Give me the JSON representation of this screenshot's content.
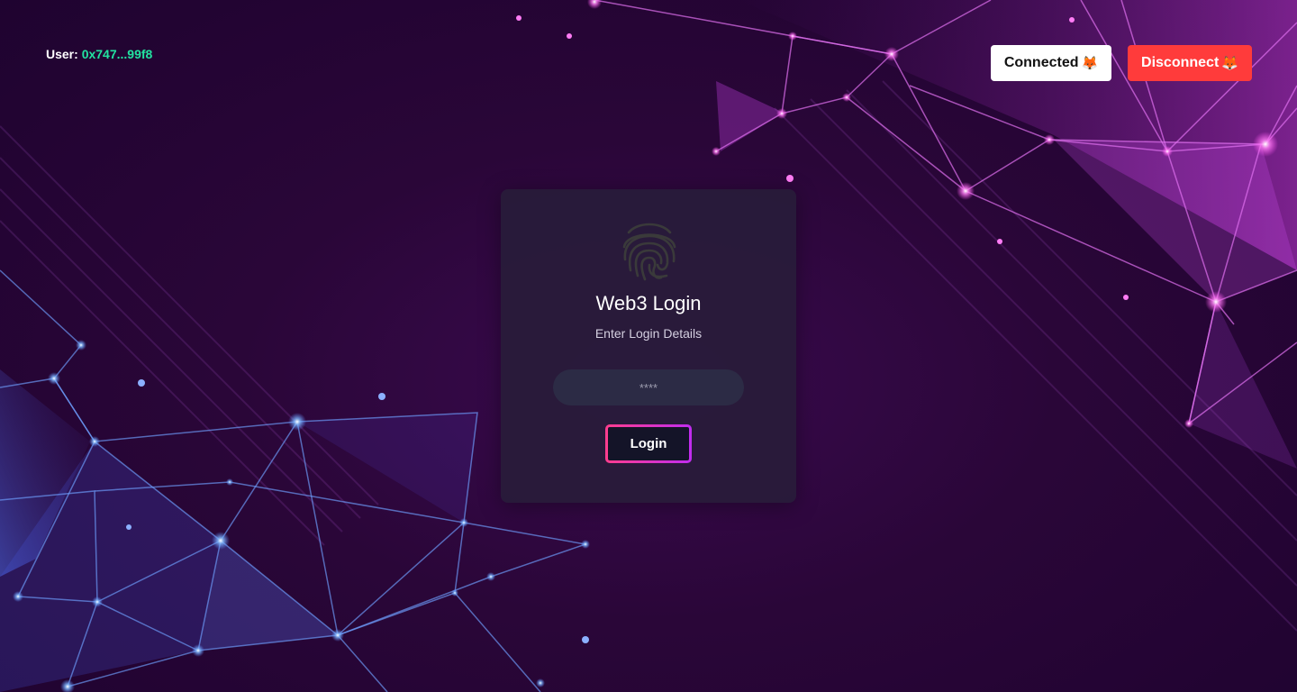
{
  "header": {
    "user_label": "User:",
    "user_address": "0x747...99f8",
    "connected_label": "Connected",
    "disconnect_label": "Disconnect",
    "wallet_icon": "metamask-fox-icon"
  },
  "card": {
    "icon": "fingerprint-icon",
    "title": "Web3 Login",
    "subtitle": "Enter Login Details",
    "password_placeholder": "****",
    "login_label": "Login"
  },
  "colors": {
    "address": "#22e3a0",
    "disconnect_bg": "#ff3b3b",
    "login_border_start": "#ff3d8e",
    "login_border_end": "#c02cf0"
  }
}
